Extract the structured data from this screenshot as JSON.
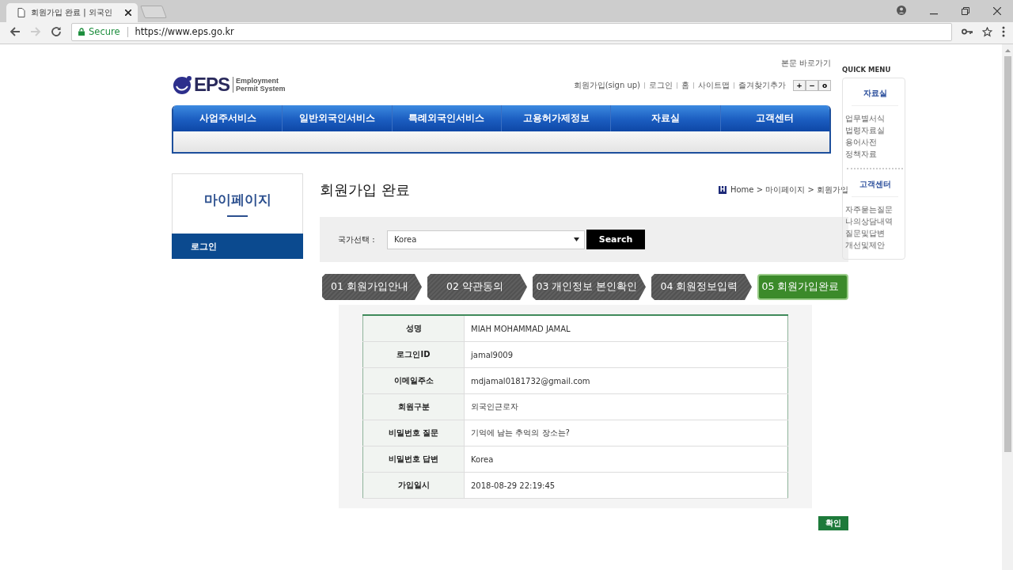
{
  "browser": {
    "tab_title": "회원가입 완료 | 외국인",
    "secure_label": "Secure",
    "url": "https://www.eps.go.kr"
  },
  "header": {
    "logo_mark": "EPS",
    "logo_line1": "Employment",
    "logo_line2": "Permit System",
    "skip_link": "본문 바로가기",
    "util_links": [
      "회원가입(sign up)",
      "로그인",
      "홈",
      "사이트맵",
      "즐겨찾기추가"
    ],
    "zoom_buttons": [
      "+",
      "−",
      "o"
    ]
  },
  "nav": [
    {
      "label": "사업주서비스",
      "selected": false
    },
    {
      "label": "일반외국인서비스",
      "selected": false
    },
    {
      "label": "특례외국인서비스",
      "selected": false
    },
    {
      "label": "고용허가제정보",
      "selected": false
    },
    {
      "label": "자료실",
      "selected": false
    },
    {
      "label": "고객센터",
      "selected": false
    }
  ],
  "sidebar": {
    "title": "마이페이지",
    "items": [
      {
        "label": "로그인",
        "selected": true
      }
    ]
  },
  "page_title": "회원가입 완료",
  "breadcrumb": {
    "home_icon": "H",
    "path": "Home > 마이페이지 > 회원가입"
  },
  "country": {
    "label": "국가선택 :",
    "value": "Korea",
    "button": "Search"
  },
  "steps": [
    {
      "label": "01 회원가입안내",
      "selected": false
    },
    {
      "label": "02 약관동의",
      "selected": false
    },
    {
      "label": "03 개인정보 본인확인",
      "selected": false
    },
    {
      "label": "04 회원정보입력",
      "selected": false
    },
    {
      "label": "05 회원가입완료",
      "selected": true
    }
  ],
  "table": {
    "rows": [
      {
        "label": "성명",
        "value": "MIAH MOHAMMAD JAMAL"
      },
      {
        "label": "로그인ID",
        "value": "jamal9009"
      },
      {
        "label": "이메일주소",
        "value": "mdjamal0181732@gmail.com"
      },
      {
        "label": "회원구분",
        "value": "외국인근로자"
      },
      {
        "label": "비밀번호 질문",
        "value": "기억에 남는 추억의 장소는?"
      },
      {
        "label": "비밀번호 답변",
        "value": "Korea"
      },
      {
        "label": "가입일시",
        "value": "2018-08-29 22:19:45"
      }
    ]
  },
  "confirm_button": "확인",
  "quick_menu": {
    "title": "QUICK MENU",
    "groups": [
      {
        "title": "자료실",
        "items": [
          "업무별서식",
          "법령자료실",
          "용어사전",
          "정책자료"
        ]
      },
      {
        "title": "고객센터",
        "items": [
          "자주묻는질문",
          "나의상담내역",
          "질문및답변",
          "개선및제안"
        ]
      }
    ]
  }
}
